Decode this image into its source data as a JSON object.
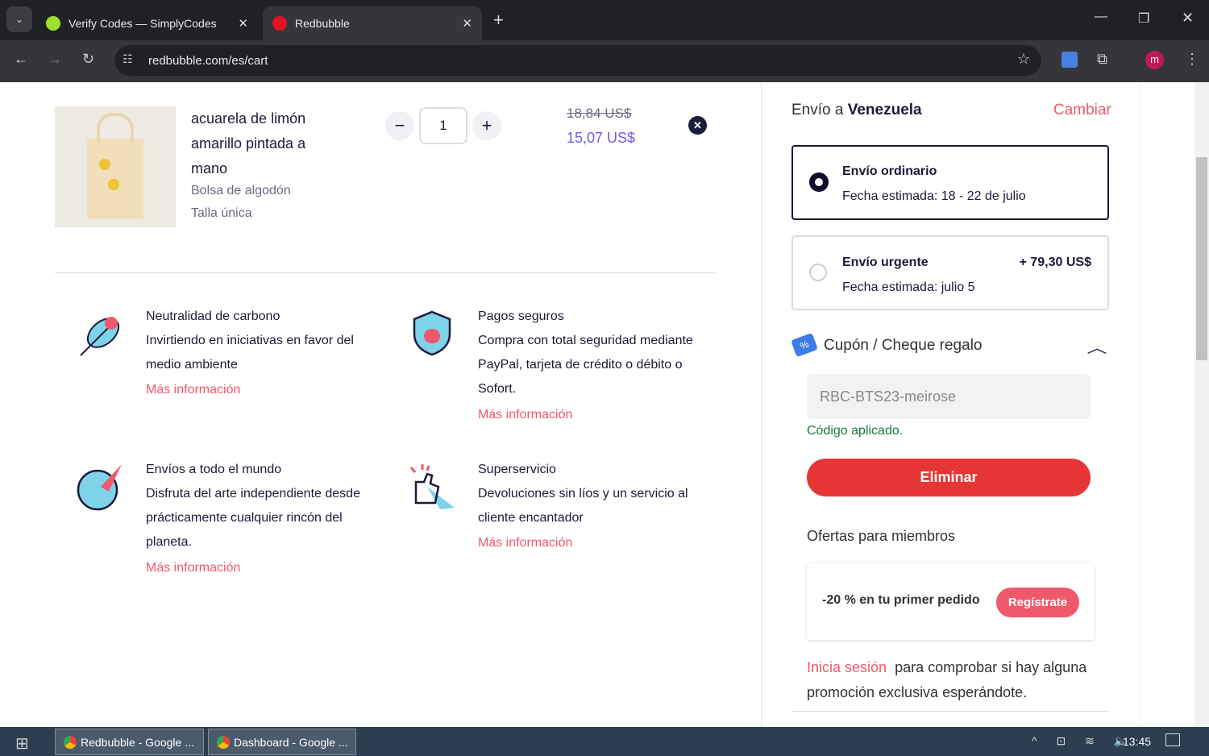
{
  "browser": {
    "tabs": [
      {
        "title": "Verify Codes — SimplyCodes"
      },
      {
        "title": "Redbubble"
      }
    ],
    "url": "redbubble.com/es/cart",
    "profile_initial": "m"
  },
  "cart": {
    "item": {
      "title": "acuarela de limón amarillo pintada a mano",
      "type": "Bolsa de algodón",
      "size": "Talla única",
      "quantity": "1",
      "old_price": "18,84 US$",
      "price": "15,07 US$"
    }
  },
  "features": [
    {
      "title": "Neutralidad de carbono",
      "text": "Invirtiendo en iniciativas en favor del medio ambiente",
      "link": "Más información"
    },
    {
      "title": "Pagos seguros",
      "text": "Compra con total seguridad mediante PayPal, tarjeta de crédito o débito o Sofort.",
      "link": "Más información"
    },
    {
      "title": "Envíos a todo el mundo",
      "text": "Disfruta del arte independiente desde prácticamente cualquier rincón del planeta.",
      "link": "Más información"
    },
    {
      "title": "Superservicio",
      "text": "Devoluciones sin líos y un servicio al cliente encantador",
      "link": "Más información"
    }
  ],
  "shipping": {
    "prefix": "Envío a",
    "country": "Venezuela",
    "change": "Cambiar",
    "options": [
      {
        "name": "Envío ordinario",
        "date": "Fecha estimada: 18 - 22 de julio",
        "price": "",
        "selected": true
      },
      {
        "name": "Envío urgente",
        "date": "Fecha estimada: julio 5",
        "price": "+ 79,30 US$",
        "selected": false
      }
    ]
  },
  "coupon": {
    "label": "Cupón / Cheque regalo",
    "value": "RBC-BTS23-meirose",
    "status": "Código aplicado.",
    "remove": "Eliminar"
  },
  "member": {
    "title": "Ofertas para miembros",
    "offer": "-20 % en tu primer pedido",
    "signup": "Regístrate",
    "login": "Inicia sesión",
    "login_rest": "para comprobar si hay alguna promoción exclusiva esperándote."
  },
  "taskbar": {
    "items": [
      "Redbubble - Google ...",
      "Dashboard - Google ..."
    ],
    "time": "13:45"
  },
  "colors": {
    "accent": "#f0596b",
    "danger": "#e63535",
    "navy": "#1a1a3a",
    "price": "#6a5de8"
  }
}
